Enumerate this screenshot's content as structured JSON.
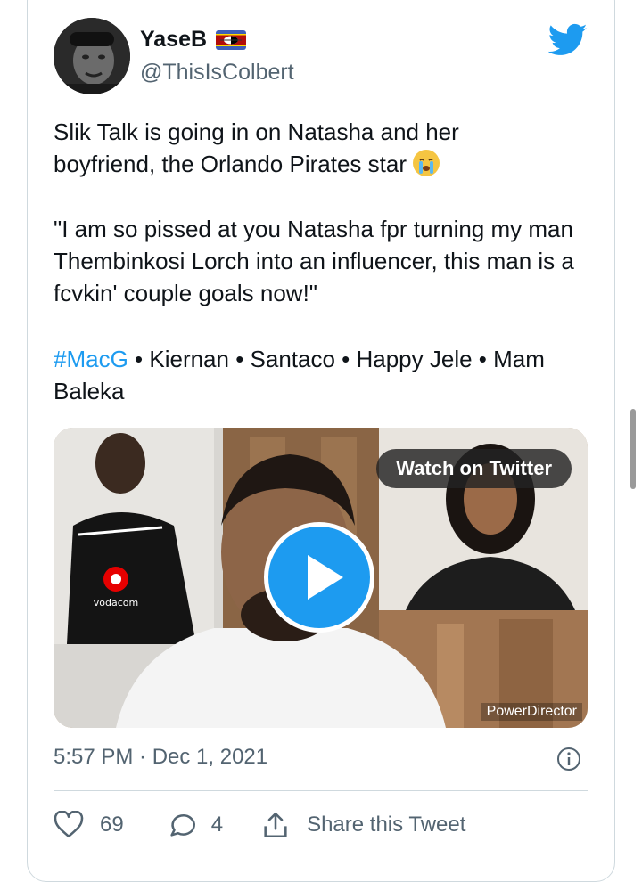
{
  "tweet": {
    "display_name": "YaseB",
    "handle": "@ThisIsColbert",
    "text_line_1": "Slik Talk is going in on Natasha and her",
    "text_line_2": "boyfriend, the Orlando Pirates star",
    "quote": "\"I am so pissed at you Natasha fpr turning my man Thembinkosi Lorch into an influencer, this man is a fcvkin' couple goals now!\"",
    "hashtag": "#MacG",
    "topics_rest": " • Kiernan • Santaco • Happy Jele • Mam Baleka",
    "timestamp": "5:57 PM · Dec 1, 2021"
  },
  "media": {
    "watch_label": "Watch on Twitter",
    "watermark": "PowerDirector",
    "jersey_text": "vodacom"
  },
  "actions": {
    "likes": "69",
    "replies": "4",
    "share_label": "Share this Tweet"
  },
  "colors": {
    "accent": "#1d9bf0",
    "secondary_text": "#536471",
    "divider": "#cfd9de"
  },
  "icons": [
    "twitter-bird-icon",
    "eswatini-flag-icon",
    "crying-face-emoji",
    "play-icon",
    "info-icon",
    "heart-icon",
    "reply-icon",
    "share-icon"
  ]
}
